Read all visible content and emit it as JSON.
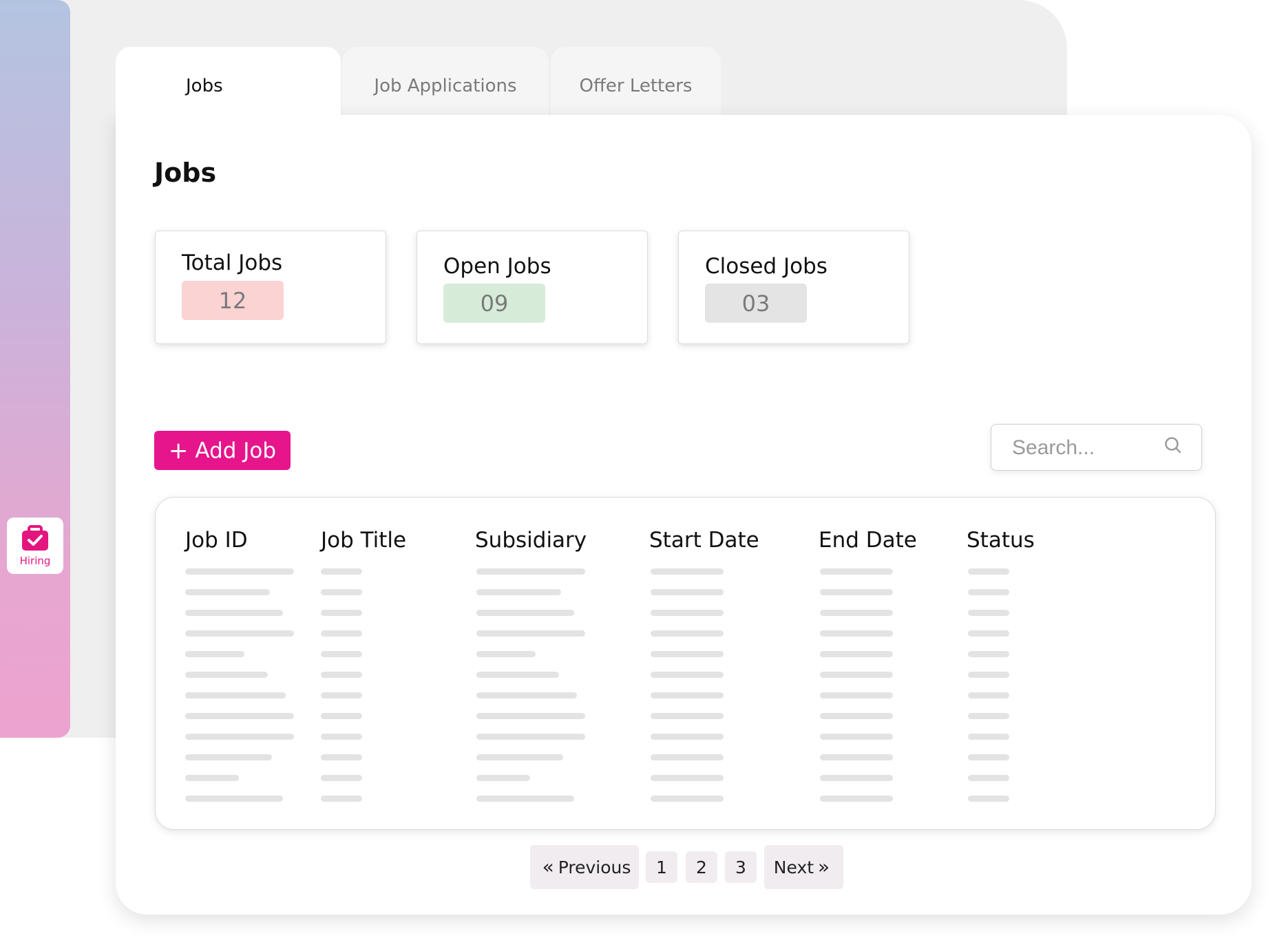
{
  "sidebar": {
    "items": [
      {
        "label": "Hiring",
        "icon": "briefcase-check-icon"
      }
    ]
  },
  "tabs": [
    {
      "label": "Jobs",
      "active": true
    },
    {
      "label": "Job Applications",
      "active": false
    },
    {
      "label": "Offer Letters",
      "active": false
    }
  ],
  "page": {
    "title": "Jobs"
  },
  "stats": {
    "total": {
      "label": "Total Jobs",
      "value": "12",
      "color": "#fbd3d3"
    },
    "open": {
      "label": "Open Jobs",
      "value": "09",
      "color": "#d6ecd9"
    },
    "closed": {
      "label": "Closed Jobs",
      "value": "03",
      "color": "#e4e4e4"
    }
  },
  "toolbar": {
    "add_label": "Add Job",
    "search_placeholder": "Search..."
  },
  "table": {
    "columns": [
      "Job ID",
      "Job Title",
      "Subsidiary",
      "Start Date",
      "End Date",
      "Status"
    ],
    "placeholder_rows": 12
  },
  "pagination": {
    "previous_label": "Previous",
    "pages": [
      "1",
      "2",
      "3"
    ],
    "next_label": "Next"
  },
  "colors": {
    "accent": "#e6158c",
    "sidebar_gradient_top": "#b3c4e1",
    "sidebar_gradient_bottom": "#eda3cf"
  }
}
